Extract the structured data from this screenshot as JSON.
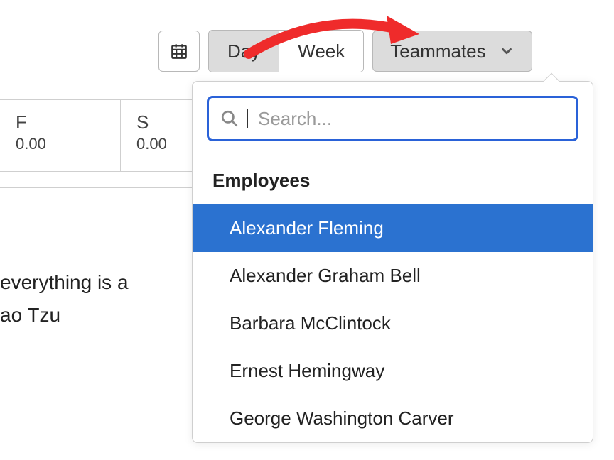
{
  "toolbar": {
    "day_label": "Day",
    "week_label": "Week",
    "teammates_label": "Teammates"
  },
  "columns": [
    {
      "letter": "F",
      "value": "0.00"
    },
    {
      "letter": "S",
      "value": "0.00"
    }
  ],
  "quote": {
    "line1": "everything is a",
    "line2": "ao Tzu"
  },
  "dropdown": {
    "search_placeholder": "Search...",
    "group_label": "Employees",
    "items": [
      "Alexander Fleming",
      "Alexander Graham Bell",
      "Barbara McClintock",
      "Ernest Hemingway",
      "George Washington Carver"
    ]
  }
}
